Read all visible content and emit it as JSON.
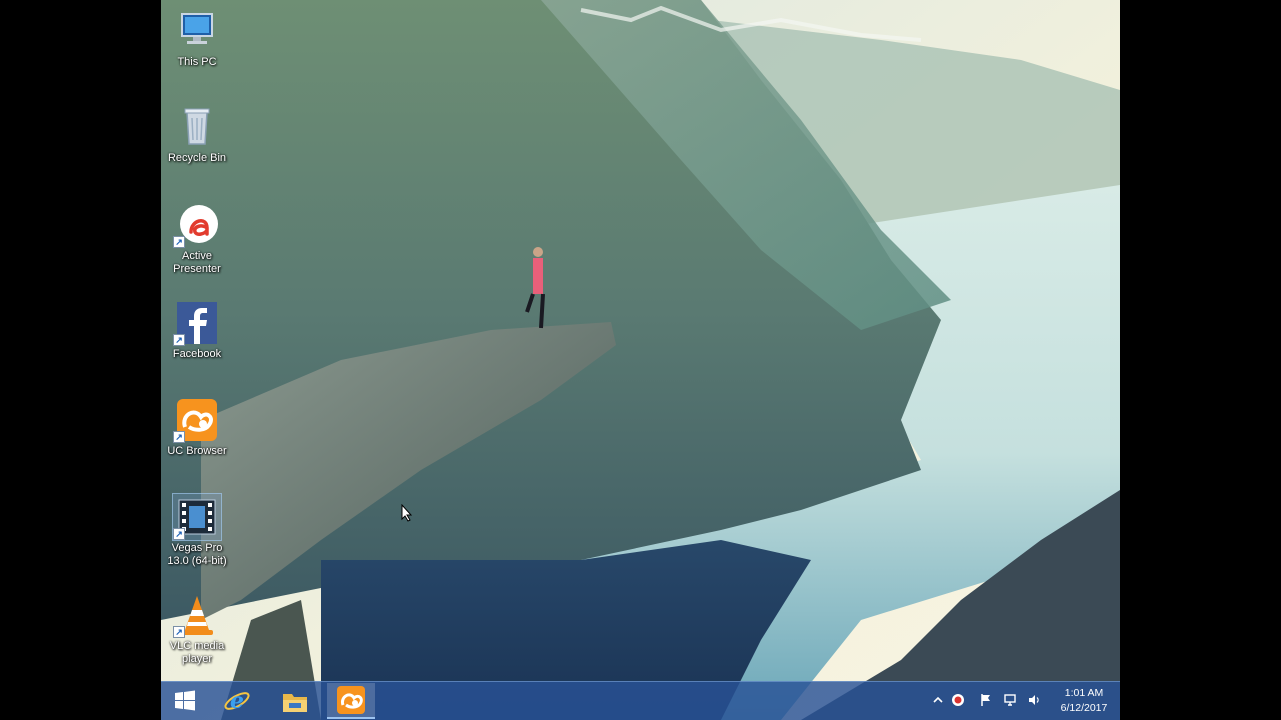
{
  "desktop": {
    "icons": [
      {
        "label": "This PC",
        "icon": "this-pc-icon"
      },
      {
        "label": "Recycle Bin",
        "icon": "recycle-bin-icon"
      },
      {
        "label": "Active Presenter",
        "icon": "activepresenter-icon"
      },
      {
        "label": "Facebook",
        "icon": "facebook-icon"
      },
      {
        "label": "UC Browser",
        "icon": "uc-browser-icon"
      },
      {
        "label": "Vegas Pro 13.0 (64-bit)",
        "icon": "vegas-pro-icon"
      },
      {
        "label": "VLC media player",
        "icon": "vlc-icon"
      }
    ]
  },
  "taskbar": {
    "buttons": [
      {
        "name": "start",
        "icon": "windows-start-icon"
      },
      {
        "name": "internet-explorer",
        "icon": "internet-explorer-icon"
      },
      {
        "name": "file-explorer",
        "icon": "file-explorer-icon"
      },
      {
        "name": "uc-browser",
        "icon": "uc-browser-icon",
        "active": true
      }
    ],
    "tray": {
      "icons": [
        "chevron-up-icon",
        "antivirus-icon",
        "flag-icon",
        "network-icon",
        "volume-icon"
      ],
      "time": "1:01 AM",
      "date": "6/12/2017"
    }
  },
  "colors": {
    "taskbar": "#2a5296",
    "facebook": "#3b5998",
    "uc_orange": "#f7931e",
    "vlc_orange": "#f28c1b"
  }
}
